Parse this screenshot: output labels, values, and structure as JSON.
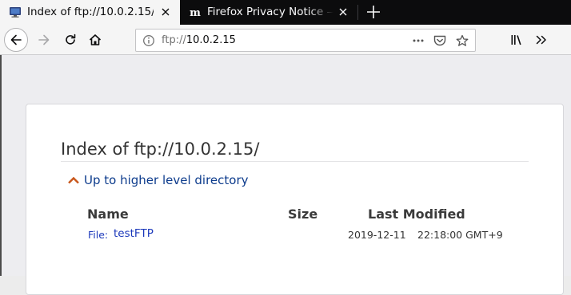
{
  "tabs": [
    {
      "title": "Index of ftp://10.0.2.15/",
      "active": true,
      "favicon": "computer-monitor-icon"
    },
    {
      "title": "Firefox Privacy Notice —",
      "active": false,
      "favicon": "mozilla-m-icon"
    }
  ],
  "navbar": {
    "url_scheme": "ftp://",
    "url_host": "10.0.2.15",
    "icons": [
      "back-arrow-icon",
      "forward-arrow-icon",
      "reload-icon",
      "home-icon",
      "info-icon",
      "page-actions-icon",
      "pocket-icon",
      "bookmark-star-icon",
      "library-icon",
      "overflow-chevron-icon"
    ]
  },
  "page": {
    "heading": "Index of ftp://10.0.2.15/",
    "up_link": "Up to higher level directory",
    "columns": {
      "name": "Name",
      "size": "Size",
      "modified": "Last Modified"
    },
    "entries": [
      {
        "type_label": "File:",
        "name": "testFTP",
        "size": "",
        "date": "2019-12-11",
        "time": "22:18:00 GMT+9"
      }
    ]
  },
  "colors": {
    "tabstrip": "#0c0c0d",
    "toolbar": "#f5f5f5",
    "link": "#1c39bb",
    "up_arrow": "#c8561a"
  }
}
